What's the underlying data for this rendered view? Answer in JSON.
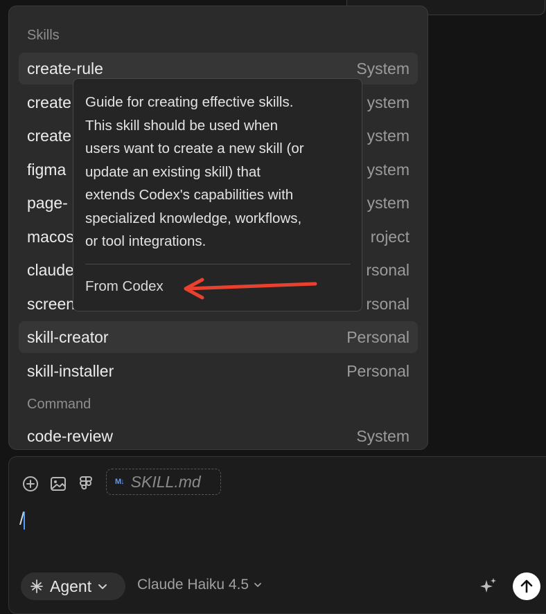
{
  "colors": {
    "background": "#141414",
    "popup": "#2b2b2b",
    "highlight_row": "#363636",
    "annotation_arrow": "#e8412f",
    "markdown_badge": "#5e9bff",
    "caret": "#4a9eff"
  },
  "popup": {
    "skills_heading": "Skills",
    "command_heading": "Command",
    "items": [
      {
        "name": "create-rule",
        "source": "System"
      },
      {
        "name": "create",
        "source": "ystem"
      },
      {
        "name": "create",
        "source": "ystem"
      },
      {
        "name": "figma",
        "source": "ystem"
      },
      {
        "name": "page-",
        "source": "ystem"
      },
      {
        "name": "macos",
        "source": "roject"
      },
      {
        "name": "claude",
        "source": "rsonal"
      },
      {
        "name": "screen",
        "source": "rsonal"
      },
      {
        "name": "skill-creator",
        "source": "Personal"
      },
      {
        "name": "skill-installer",
        "source": "Personal"
      }
    ],
    "command_items": [
      {
        "name": "code-review",
        "source": "System"
      }
    ]
  },
  "tooltip": {
    "lines": [
      "Guide for creating effective skills.",
      "This skill should be used when",
      "users want to create a new skill (or",
      "update an existing skill) that",
      "extends Codex's capabilities with",
      "specialized knowledge, workflows,",
      "or tool integrations."
    ],
    "from": "From Codex"
  },
  "composer": {
    "toolbar_icons": [
      "plus-circle-icon",
      "image-icon",
      "figma-icon"
    ],
    "attachment_badge": "M↓",
    "attachment": "SKILL.md",
    "input_value": "/",
    "agent_label": "Agent",
    "model_label": "Claude Haiku 4.5"
  }
}
